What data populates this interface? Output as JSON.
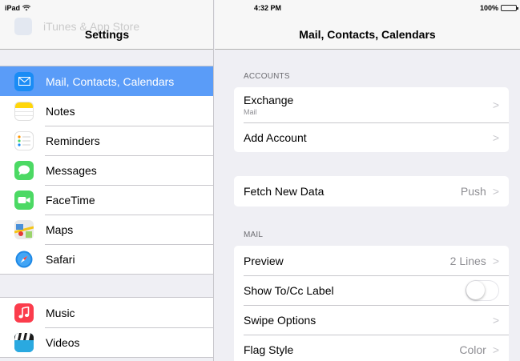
{
  "status_bar": {
    "device": "iPad",
    "time": "4:32 PM",
    "battery_percent": "100%"
  },
  "sidebar": {
    "ghost_label": "iTunes & App Store",
    "title": "Settings",
    "group1": [
      {
        "label": "Mail, Contacts, Calendars",
        "icon": "mail-icon",
        "color": "#1a8cf5",
        "active": true
      },
      {
        "label": "Notes",
        "icon": "notes-icon",
        "color": "#ffd60a"
      },
      {
        "label": "Reminders",
        "icon": "reminders-icon",
        "color": "#ffffff"
      },
      {
        "label": "Messages",
        "icon": "messages-icon",
        "color": "#4cd964"
      },
      {
        "label": "FaceTime",
        "icon": "facetime-icon",
        "color": "#4cd964"
      },
      {
        "label": "Maps",
        "icon": "maps-icon",
        "color": "#e9e9e9"
      },
      {
        "label": "Safari",
        "icon": "safari-icon",
        "color": "#1e88e5"
      }
    ],
    "group2": [
      {
        "label": "Music",
        "icon": "music-icon",
        "color": "#fb3c4c"
      },
      {
        "label": "Videos",
        "icon": "videos-icon",
        "color": "#2aa9e0"
      }
    ]
  },
  "detail": {
    "title": "Mail, Contacts, Calendars",
    "accounts_header": "ACCOUNTS",
    "exchange_label": "Exchange",
    "exchange_sub": "Mail",
    "add_account_label": "Add Account",
    "fetch_label": "Fetch New Data",
    "fetch_value": "Push",
    "mail_header": "MAIL",
    "preview_label": "Preview",
    "preview_value": "2 Lines",
    "show_tocc_label": "Show To/Cc Label",
    "show_tocc_on": false,
    "swipe_label": "Swipe Options",
    "flag_label": "Flag Style",
    "flag_value": "Color",
    "chevron": ">"
  }
}
